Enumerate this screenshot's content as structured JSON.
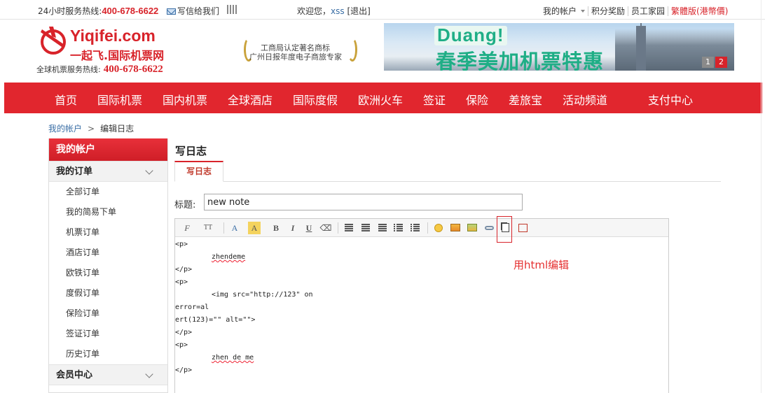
{
  "topbar": {
    "hotline_label": "24小时服务热线:",
    "hotline_number": "400-678-6622",
    "mail_label": "写信给我们",
    "welcome_label": "欢迎您，",
    "username": "xss",
    "logout_label": "[退出]",
    "my_account": "我的帐户",
    "points": "积分奖励",
    "staff": "员工家园",
    "traditional": "繁體版(港幣價)"
  },
  "header": {
    "brand_en": "Yiqifei.com",
    "brand_cn": "一起飞.国际机票网",
    "hotline_label": "全球机票服务热线:",
    "hotline_number": "400-678-6622",
    "award_line1": "工商局认定著名商标",
    "award_line2": "广州日报年度电子商旅专家",
    "banner_duang": "Duang!",
    "banner_promo": "春季美加机票特惠",
    "banner_pages": [
      "1",
      "2"
    ]
  },
  "nav": {
    "items": [
      "首页",
      "国际机票",
      "国内机票",
      "全球酒店",
      "国际度假",
      "欧洲火车",
      "签证",
      "保险",
      "差旅宝",
      "活动频道",
      "支付中心"
    ]
  },
  "breadcrumb": {
    "parent": "我的帐户",
    "separator": ">",
    "current": "编辑日志"
  },
  "sidebar": {
    "header": "我的帐户",
    "orders_group": "我的订单",
    "items": [
      "全部订单",
      "我的简易下单",
      "机票订单",
      "酒店订单",
      "欧铁订单",
      "度假订单",
      "保险订单",
      "签证订单",
      "历史订单"
    ],
    "member_group": "会员中心"
  },
  "content": {
    "page_title": "写日志",
    "tab_label": "写日志",
    "title_label": "标题:",
    "title_value": "new note"
  },
  "editor": {
    "toolbar": {
      "font_family": "F",
      "font_size": "TT",
      "font_color": "A",
      "bg_color": "A",
      "bold": "B",
      "italic": "I",
      "underline": "U"
    },
    "code_lines": [
      "<p>",
      "zhendeme",
      "</p>",
      "<p>",
      "<img src=\"http://123\" on",
      "error=al",
      "ert(123)=\"\" alt=\"\">",
      "</p>",
      "<p>",
      "zhen de me",
      "</p>"
    ]
  },
  "annotation": "用html编辑",
  "colors": {
    "brand_red": "#e1262e",
    "link_blue": "#3a6ea5",
    "banner_green": "#1fae86"
  }
}
